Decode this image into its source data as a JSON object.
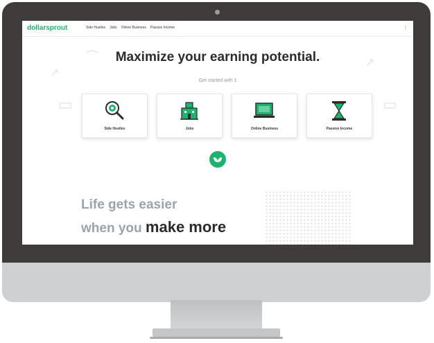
{
  "site": {
    "logo": "dollarsprout",
    "nav": [
      "Side Hustles",
      "Jobs",
      "Online Business",
      "Passive Income"
    ],
    "nav_right": "⋮"
  },
  "hero": {
    "headline": "Maximize your earning potential.",
    "subline": "Get started with 1",
    "cards": [
      {
        "label": "Side Hustles",
        "icon": "magnifier-gear-icon"
      },
      {
        "label": "Jobs",
        "icon": "building-icon"
      },
      {
        "label": "Online Business",
        "icon": "laptop-icon"
      },
      {
        "label": "Passive Income",
        "icon": "hourglass-icon"
      }
    ]
  },
  "tagline": {
    "line1": "Life gets easier",
    "line2_prefix": "when you ",
    "line2_emphasis": "make more"
  },
  "colors": {
    "brand_green": "#1db36e",
    "bezel": "#3f3b3b",
    "chin": "#cfd0d1"
  }
}
